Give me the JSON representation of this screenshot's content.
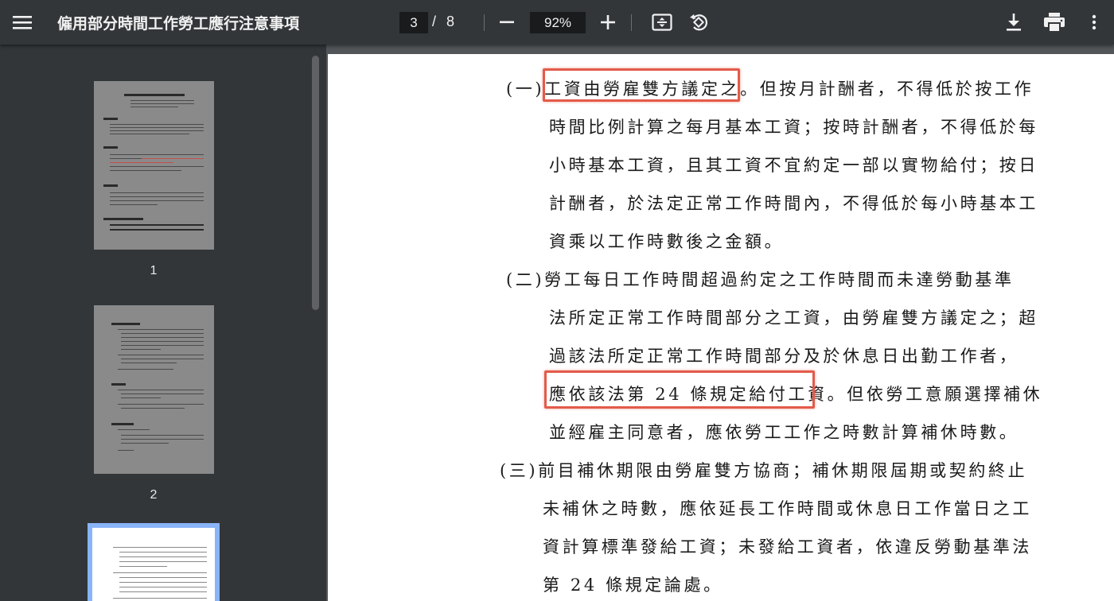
{
  "toolbar": {
    "title": "僱用部分時間工作勞工應行注意事項",
    "current_page": "3",
    "page_separator": "/",
    "total_pages": "8",
    "zoom": "92%",
    "icons": [
      "menu-icon",
      "minus-icon",
      "plus-icon",
      "fit-page-icon",
      "rotate-icon",
      "download-icon",
      "print-icon",
      "more-vert-icon"
    ]
  },
  "sidebar": {
    "thumbnails": [
      {
        "label": "1"
      },
      {
        "label": "2"
      }
    ],
    "selected_index": 2
  },
  "document": {
    "lines": [
      "(一)工資由勞雇雙方議定之。但按月計酬者，不得低於按工作",
      "時間比例計算之每月基本工資；按時計酬者，不得低於每",
      "小時基本工資，且其工資不宜約定一部以實物給付；按日",
      "計酬者，於法定正常工作時間內，不得低於每小時基本工",
      "資乘以工作時數後之金額。",
      "(二)勞工每日工作時間超過約定之工作時間而未達勞動基準",
      "法所定正常工作時間部分之工資，由勞雇雙方議定之；超",
      "過該法所定正常工作時間部分及於休息日出勤工作者，",
      "應依該法第 24 條規定給付工資。但依勞工意願選擇補休",
      "並經雇主同意者，應依勞工工作之時數計算補休時數。",
      "(三)前目補休期限由勞雇雙方協商；補休期限屆期或契約終止",
      "未補休之時數，應依延長工作時間或休息日工作當日之工",
      "資計算標準發給工資；未發給工資者，依違反勞動基準法",
      "第 24 條規定論處。"
    ]
  }
}
